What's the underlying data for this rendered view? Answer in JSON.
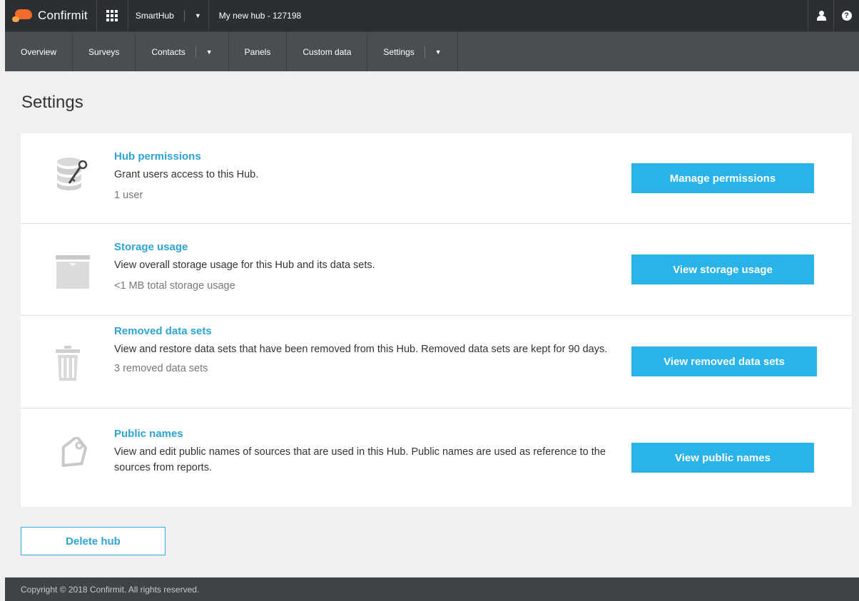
{
  "topbar": {
    "brand": "Confirmit",
    "hub_switch_label": "SmartHub",
    "hub_name": "My new hub - 127198"
  },
  "nav": {
    "items": [
      {
        "label": "Overview"
      },
      {
        "label": "Surveys"
      },
      {
        "label": "Contacts"
      },
      {
        "label": "Panels"
      },
      {
        "label": "Custom data"
      },
      {
        "label": "Settings"
      }
    ]
  },
  "page": {
    "title": "Settings"
  },
  "sections": {
    "permissions": {
      "title": "Hub permissions",
      "description": "Grant users access to this Hub.",
      "meta": "1 user",
      "button": "Manage permissions"
    },
    "storage": {
      "title": "Storage usage",
      "description": "View overall storage usage for this Hub and its data sets.",
      "meta": "<1 MB total storage usage",
      "button": "View storage usage"
    },
    "removed": {
      "title": "Removed data sets",
      "description": "View and restore data sets that have been removed from this Hub. Removed data sets are kept for 90 days.",
      "meta": "3 removed data sets",
      "button": "View removed data sets"
    },
    "public_names": {
      "title": "Public names",
      "description": "View and edit public names of sources that are used in this Hub. Public names are used as reference to the sources from reports.",
      "button": "View public names"
    }
  },
  "delete_button": "Delete hub",
  "footer": {
    "copyright": "Copyright © 2018 Confirmit. All rights reserved."
  },
  "colors": {
    "accent": "#29b3e8",
    "link": "#2ea3d4",
    "topbar": "#2b2f33",
    "navbar": "#494e53"
  }
}
